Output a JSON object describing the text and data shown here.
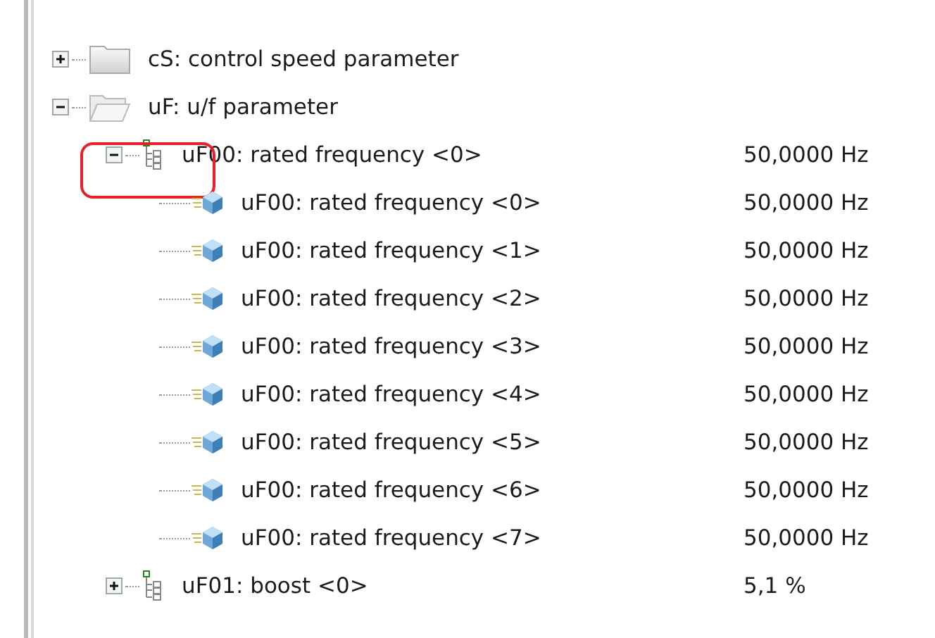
{
  "tree": [
    {
      "kind": "folder",
      "label": "cS: control speed parameter",
      "expanded": false
    },
    {
      "kind": "folder",
      "label": "uF: u/f parameter",
      "expanded": true,
      "children": [
        {
          "kind": "group",
          "label": "uF00: rated frequency <0>",
          "value": "50,0000 Hz",
          "expanded": true,
          "highlighted": true,
          "children": [
            {
              "kind": "param",
              "label": "uF00: rated frequency <0>",
              "value": "50,0000 Hz"
            },
            {
              "kind": "param",
              "label": "uF00: rated frequency <1>",
              "value": "50,0000 Hz"
            },
            {
              "kind": "param",
              "label": "uF00: rated frequency <2>",
              "value": "50,0000 Hz"
            },
            {
              "kind": "param",
              "label": "uF00: rated frequency <3>",
              "value": "50,0000 Hz"
            },
            {
              "kind": "param",
              "label": "uF00: rated frequency <4>",
              "value": "50,0000 Hz"
            },
            {
              "kind": "param",
              "label": "uF00: rated frequency <5>",
              "value": "50,0000 Hz"
            },
            {
              "kind": "param",
              "label": "uF00: rated frequency <6>",
              "value": "50,0000 Hz"
            },
            {
              "kind": "param",
              "label": "uF00: rated frequency <7>",
              "value": "50,0000 Hz"
            }
          ]
        },
        {
          "kind": "group",
          "label": "uF01: boost <0>",
          "value": "5,1 %",
          "expanded": false
        }
      ]
    }
  ]
}
